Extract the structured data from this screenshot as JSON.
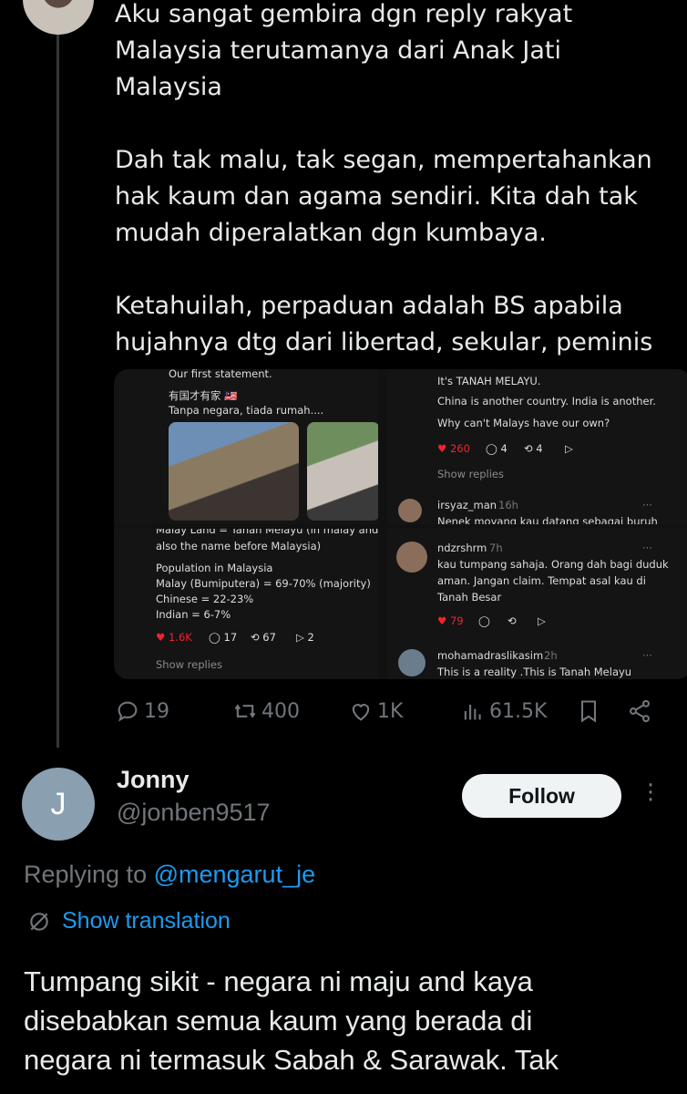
{
  "tweet": {
    "paragraphs": [
      "Aku sangat gembira dgn reply rakyat\nMalaysia terutamanya dari Anak Jati\nMalaysia",
      "Dah tak malu, tak segan, mempertahankan\nhak kaum dan agama sendiri. Kita dah tak\nmudah diperalatkan dgn kumbaya.",
      "Ketahuilah, perpaduan adalah BS apabila\nhujahnya dtg dari libertad, sekular, peminis"
    ],
    "media": {
      "p1": {
        "line1": "Our first statement.",
        "line2": "有国才有家 🇲🇾",
        "line3": "Tanpa negara, tiada rumah...."
      },
      "p2": {
        "line1": "It's TANAH MELAYU.",
        "line2": "China is another country. India is another.",
        "line3": "Why can't Malays have our own?",
        "likes": "260",
        "replies": "4",
        "reposts": "4",
        "show_replies": "Show replies",
        "user": "irsyaz_man",
        "time": "16h",
        "cut": "Nenek moyang kau datang sebagai buruh"
      },
      "p3": {
        "line0": "Malay Land = Tanah Melayu (in malay and",
        "line1": "also the name before Malaysia)",
        "line2": "Population in Malaysia",
        "line3": "Malay (Bumiputera) = 69-70% (majority)",
        "line4": "Chinese = 22-23%",
        "line5": "Indian = 6-7%",
        "likes": "1.6K",
        "replies": "17",
        "reposts": "67",
        "shares": "2",
        "show_replies": "Show replies"
      },
      "p4": {
        "user": "ndzrshrm",
        "time": "7h",
        "text1": "kau tumpang sahaja. Orang dah bagi duduk",
        "text2": "aman. Jangan claim. Tempat asal kau di",
        "text3": "Tanah Besar",
        "likes": "79",
        "user2": "mohamadraslikasim",
        "time2": "2h",
        "text4": "This is a reality .This is Tanah Melayu"
      }
    },
    "stats": {
      "replies": "19",
      "reposts": "400",
      "likes": "1K",
      "views": "61.5K"
    }
  },
  "reply": {
    "avatar_letter": "J",
    "name": "Jonny",
    "handle": "@jonben9517",
    "follow_label": "Follow",
    "replying_prefix": "Replying to ",
    "replying_mention": "@mengarut_je",
    "translation_label": "Show translation",
    "body": "Tumpang sikit - negara ni maju and kaya\ndisebabkan semua kaum yang berada di\nnegara ni termasuk Sabah & Sarawak. Tak"
  },
  "colors": {
    "accent": "#1d9bf0",
    "muted": "#71767b",
    "like": "#f4212e",
    "background": "#000000"
  }
}
